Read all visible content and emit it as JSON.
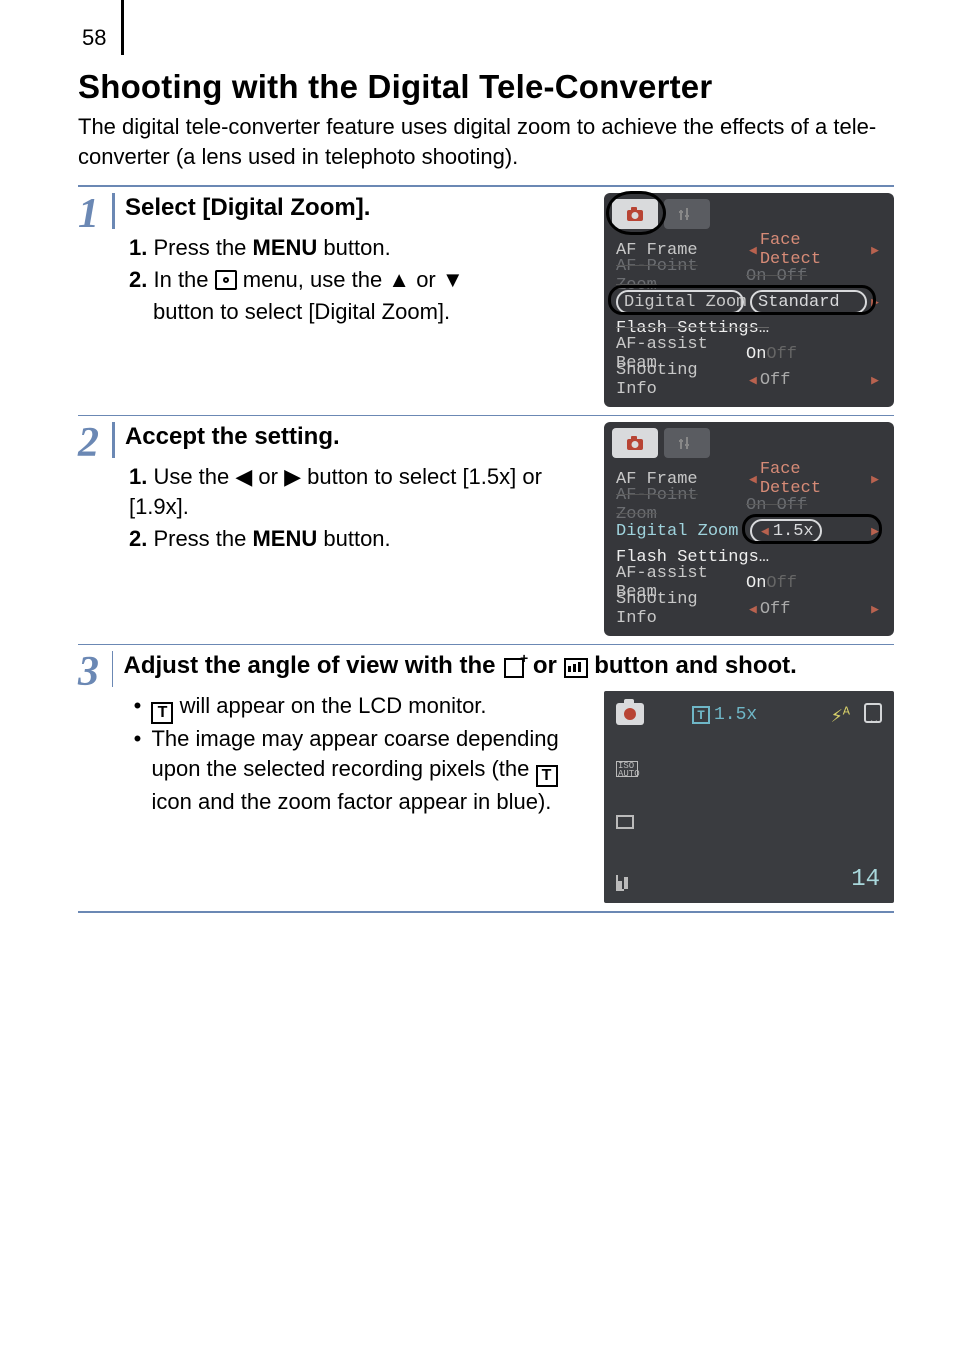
{
  "page_number": "58",
  "title": "Shooting with the Digital Tele-Converter",
  "intro": "The digital tele-converter feature uses digital zoom to achieve the effects of a tele-converter (a lens used in telephoto shooting).",
  "steps": {
    "s1": {
      "num": "1",
      "title": "Select [Digital Zoom].",
      "l1_n": "1.",
      "l1_a": "Press the ",
      "l1_b": "MENU",
      "l1_c": " button.",
      "l2_n": "2.",
      "l2_a": "In the ",
      "l2_b": " menu, use the ",
      "l2_c": " or ",
      "l2_d": " button to select [Digital Zoom].",
      "arrow_up": "▲",
      "arrow_dn": "▼",
      "menu": {
        "af_frame_l": "AF Frame",
        "af_frame_v": "Face Detect",
        "af_point_l": "AF-Point Zoom",
        "af_point_on": "On",
        "af_point_off": "Off",
        "dz_l": "Digital Zoom",
        "dz_v": "Standard",
        "flash_l": "Flash Settings…",
        "beam_l": "AF-assist Beam",
        "beam_on": "On",
        "beam_off": "Off",
        "info_l": "Shooting Info",
        "info_v": "Off"
      }
    },
    "s2": {
      "num": "2",
      "title": "Accept the setting.",
      "l1_n": "1.",
      "l1_a": "Use the ",
      "l1_b": " or ",
      "l1_c": " button to select [1.5x] or [1.9x].",
      "l2_n": "2.",
      "l2_a": "Press the ",
      "l2_b": "MENU",
      "l2_c": " button.",
      "arrow_l": "◀",
      "arrow_r": "▶",
      "menu": {
        "af_frame_l": "AF Frame",
        "af_frame_v": "Face Detect",
        "af_point_l": "AF-Point Zoom",
        "af_point_on": "On",
        "af_point_off": "Off",
        "dz_l": "Digital Zoom",
        "dz_v": "1.5x",
        "flash_l": "Flash Settings…",
        "beam_l": "AF-assist Beam",
        "beam_on": "On",
        "beam_off": "Off",
        "info_l": "Shooting Info",
        "info_v": "Off"
      }
    },
    "s3": {
      "num": "3",
      "title_a": "Adjust the angle of view with the ",
      "title_b": " or ",
      "title_c": " button and shoot.",
      "b1_a": " will appear on the LCD monitor.",
      "b2_a": "The image may appear coarse depending upon the selected recording pixels (the ",
      "b2_b": " icon and the zoom factor appear in blue).",
      "t_label": "T",
      "lcd": {
        "zoom": "1.5x",
        "flash": "A",
        "iso1": "ISO",
        "iso2": "AUTO",
        "shots": "14"
      }
    }
  }
}
